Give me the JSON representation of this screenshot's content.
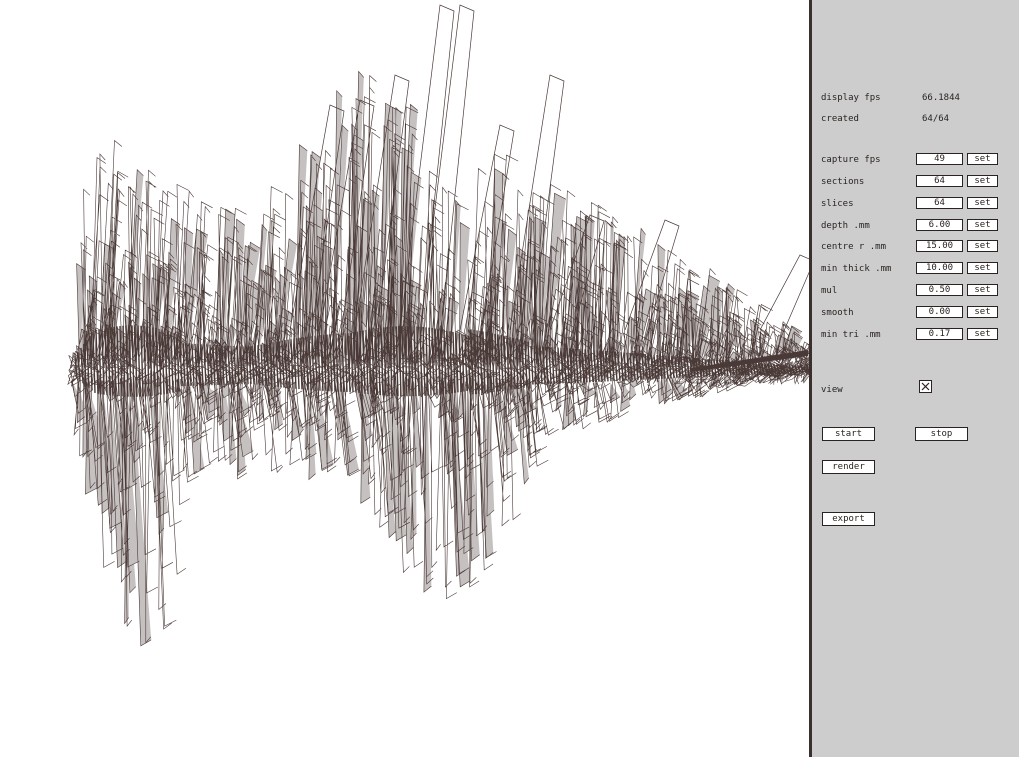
{
  "colors": {
    "mesh_dark": "#4a3a37",
    "mesh_mid": "#8e8483",
    "panel_bg": "#cdcdcd",
    "text": "#2a2320"
  },
  "stats": {
    "display_fps_label": "display fps",
    "display_fps_value": "66.1844",
    "created_label": "created",
    "created_value": "64/64"
  },
  "params": [
    {
      "label": "capture fps",
      "value": "49",
      "button": "set"
    },
    {
      "label": "sections",
      "value": "64",
      "button": "set"
    },
    {
      "label": "slices",
      "value": "64",
      "button": "set"
    },
    {
      "label": "depth .mm",
      "value": "6.00",
      "button": "set"
    },
    {
      "label": "centre r .mm",
      "value": "15.00",
      "button": "set"
    },
    {
      "label": "min thick .mm",
      "value": "10.00",
      "button": "set"
    },
    {
      "label": "mul",
      "value": "0.50",
      "button": "set"
    },
    {
      "label": "smooth",
      "value": "0.00",
      "button": "set"
    },
    {
      "label": "min tri .mm",
      "value": "0.17",
      "button": "set"
    }
  ],
  "view": {
    "label": "view",
    "checked": true,
    "icon": "x-check-icon"
  },
  "buttons": {
    "start": "start",
    "stop": "stop",
    "render": "render",
    "export": "export"
  }
}
